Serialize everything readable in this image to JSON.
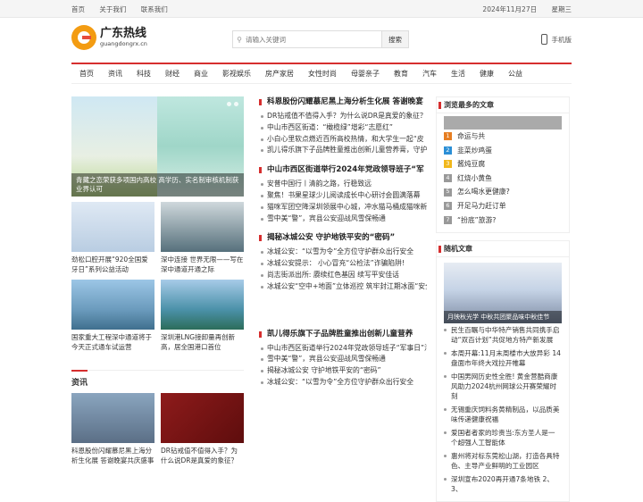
{
  "topbar": {
    "home": "首页",
    "about": "关于我们",
    "contact": "联系我们",
    "date": "2024年11月27日",
    "weekday": "星期三"
  },
  "logo": {
    "name": "广东热线",
    "domain": "guangdongrx.cn"
  },
  "search": {
    "placeholder": "请输入关键词",
    "button": "搜索"
  },
  "mobile": "手机版",
  "nav": [
    "首页",
    "资讯",
    "科技",
    "财经",
    "商业",
    "影视娱乐",
    "房产家居",
    "女性时尚",
    "母婴亲子",
    "教育",
    "汽车",
    "生活",
    "健康",
    "公益"
  ],
  "hero": {
    "caption": "青藏之恋荣获多项国内高校 高学历、实名制审核机制获业界认可"
  },
  "cards1": [
    {
      "title": "劲松口腔开展“920全国爱牙日”系列公益活动"
    },
    {
      "title": "深中连接 世界无限——写在深中通道开通之际"
    },
    {
      "title": "国家重大工程深中通道将于今天正式通车试运营"
    },
    {
      "title": "深圳港LNG接卸量再创新高，居全国港口首位"
    }
  ],
  "section2": {
    "title": "资讯"
  },
  "cards2": [
    {
      "title": "科恩股份闪耀慕尼黑上海分析生化展 答谢晚宴共庆盛事"
    },
    {
      "title": "DR钻戒值不值得入手？为什么说DR是真爱的象征？"
    }
  ],
  "groups": [
    {
      "head": "科恩股份闪耀慕尼黑上海分析生化展 答谢晚宴",
      "items": [
        "DR钻戒值不值得入手？为什么说DR是真爱的象征？",
        "中山市西区街道：“橄榄绿”增彩“志愿红”",
        "小白心里软点燃近百所高校热情，和大学生一起“皮",
        "凯儿得乐旗下子品牌胜童推出创新儿童营养膏，守护"
      ]
    },
    {
      "head": "中山市西区街道举行2024年党政领导班子“军",
      "items": [
        "安普中国行丨清韵之路，行稳致远",
        "聚焦！书果星球少儿阅读成长中心研讨会圆满落幕",
        "猫咪军团空降深圳领展中心城，冲水猫马桶成猫咪新",
        "雪中美“警”，宾县公安迎战风雪保畅通"
      ]
    },
    {
      "head": "揭秘冰城公安 守护地铁平安的“密码”",
      "items": [
        "冰城公安：“以雪为令”全方位守护群众出行安全",
        "冰城公安提示： 小心冒充“公检法”诈骗陷阱!",
        "尚志街派出所: 赓续红色基因 续写平安佳话",
        "冰城公安“空中+地面”立体巡控 筑牢封江期冰面“安全"
      ]
    },
    {
      "head": "凯儿得乐旗下子品牌胜童推出创新儿童营养",
      "items": [
        "中山市西区街道举行2024年党政领导班子“军事日”活",
        "雪中美“警”，宾县公安迎战风雪保畅通",
        "揭秘冰城公安 守护地铁平安的“密码”",
        "冰城公安：“以雪为令”全方位守护群众出行安全"
      ]
    }
  ],
  "rank": {
    "title": "浏览最多的文章",
    "items": [
      "",
      "命运与共",
      "韭菜炒鸡蛋",
      "酱炖豆腐",
      "红烧小黄鱼",
      "怎么喝水更健康?",
      "开足马力赶订单",
      "“扮底”旅游?"
    ]
  },
  "random": {
    "title": "随机文章",
    "caption": "月映秋光学 中秋共团聚品味中秋佳节",
    "items": [
      "民生百瞩与中华特产销售共同携手启动“双百计划”共促地方特产新发展",
      "本周开幕:11月末周楼市大放异彩 14盘面市年终大戏拉开帷幕",
      "中国男网历史性全胜! 黄金营酷商康风助力2024杭州网球公开赛荣耀时刻",
      "无锡重庆饲料务黄精制品，以品质美味传递健康祝福",
      "爱国者者家的珍贵当:东方圣人是一个超强人工智能体",
      "惠州将对标东莞松山湖，打造各具特色、主导产业鲜明的工业园区",
      "深圳宣布2020再开通7条地铁 2、3、"
    ]
  },
  "colors": {
    "accent": "#d62e2e",
    "rank": [
      "#aaa",
      "#e67e22",
      "#2b8fd6",
      "#f1b81c",
      "#999",
      "#999",
      "#999",
      "#999"
    ]
  }
}
